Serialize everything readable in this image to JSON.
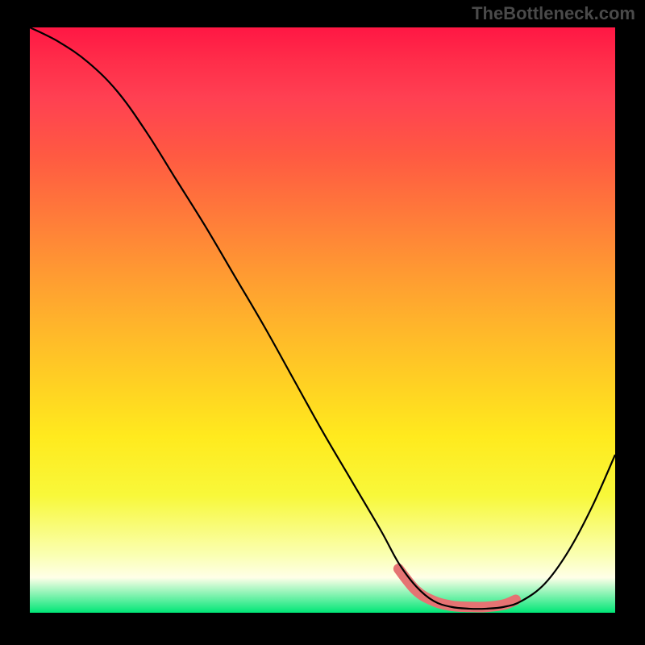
{
  "watermark": "TheBottleneck.com",
  "chart_data": {
    "type": "line",
    "title": "",
    "xlabel": "",
    "ylabel": "",
    "xlim": [
      0,
      100
    ],
    "ylim": [
      0,
      100
    ],
    "grid": false,
    "series": [
      {
        "name": "bottleneck-curve",
        "x": [
          0,
          5,
          10,
          15,
          20,
          25,
          30,
          35,
          40,
          45,
          50,
          55,
          60,
          63,
          66,
          69,
          72,
          75,
          78,
          81,
          84,
          88,
          92,
          96,
          100
        ],
        "y": [
          100,
          97.5,
          94,
          89,
          82,
          74,
          66,
          57.5,
          49,
          40,
          31,
          22.5,
          14,
          8.5,
          4.5,
          2,
          1,
          0.7,
          0.7,
          1,
          2,
          5,
          10.5,
          18,
          27
        ]
      }
    ],
    "highlight": {
      "name": "optimal-region",
      "x": [
        63,
        66,
        69,
        72,
        75,
        78,
        81,
        83
      ],
      "y": [
        7.5,
        3.8,
        2,
        1.2,
        1,
        1,
        1.4,
        2.2
      ]
    },
    "gradient_stops": [
      {
        "pos": 0,
        "color": "#ff1744"
      },
      {
        "pos": 32,
        "color": "#ff7a3a"
      },
      {
        "pos": 62,
        "color": "#ffd422"
      },
      {
        "pos": 90,
        "color": "#faffb0"
      },
      {
        "pos": 100,
        "color": "#00e676"
      }
    ]
  }
}
